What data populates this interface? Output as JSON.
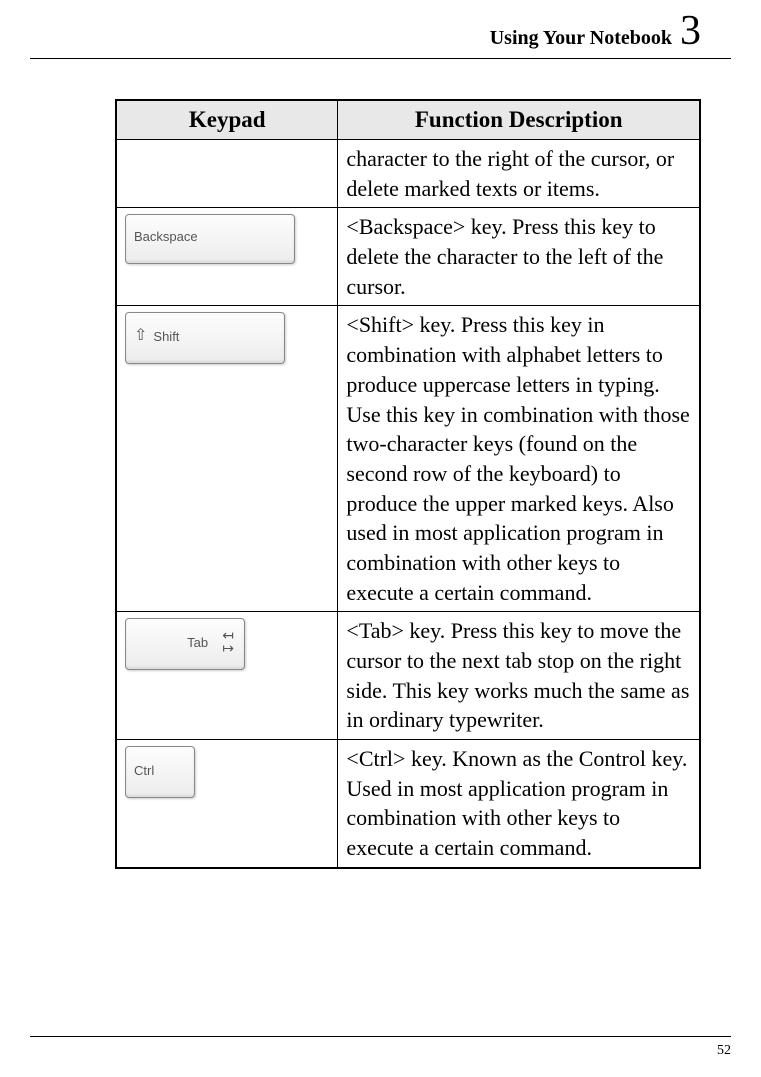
{
  "header": {
    "title": "Using Your Notebook",
    "chapter": "3"
  },
  "table": {
    "headers": {
      "col1": "Keypad",
      "col2": "Function Description"
    },
    "rows": [
      {
        "key_label": "",
        "key_type": "none",
        "description": "character to the right of the cursor, or delete marked texts or items."
      },
      {
        "key_label": "Backspace",
        "key_type": "backspace",
        "description": "<Backspace> key. Press this key to delete the character to the left of the cursor."
      },
      {
        "key_label": "Shift",
        "key_type": "shift",
        "description": "<Shift> key. Press this key in combination with alphabet letters to produce uppercase letters in typing. Use this key in combination with those two-character keys (found on the second row of the keyboard) to produce the upper marked keys. Also used in most application program in combination with other keys to execute a certain command."
      },
      {
        "key_label": "Tab",
        "key_type": "tab",
        "description": "<Tab> key. Press this key to move the cursor to the next tab stop on the right side. This key works much the same as in ordinary typewriter."
      },
      {
        "key_label": "Ctrl",
        "key_type": "ctrl",
        "description": "<Ctrl> key. Known as the Control key. Used in most application program in combination with other keys to execute a certain command."
      }
    ]
  },
  "footer": {
    "page": "52"
  }
}
